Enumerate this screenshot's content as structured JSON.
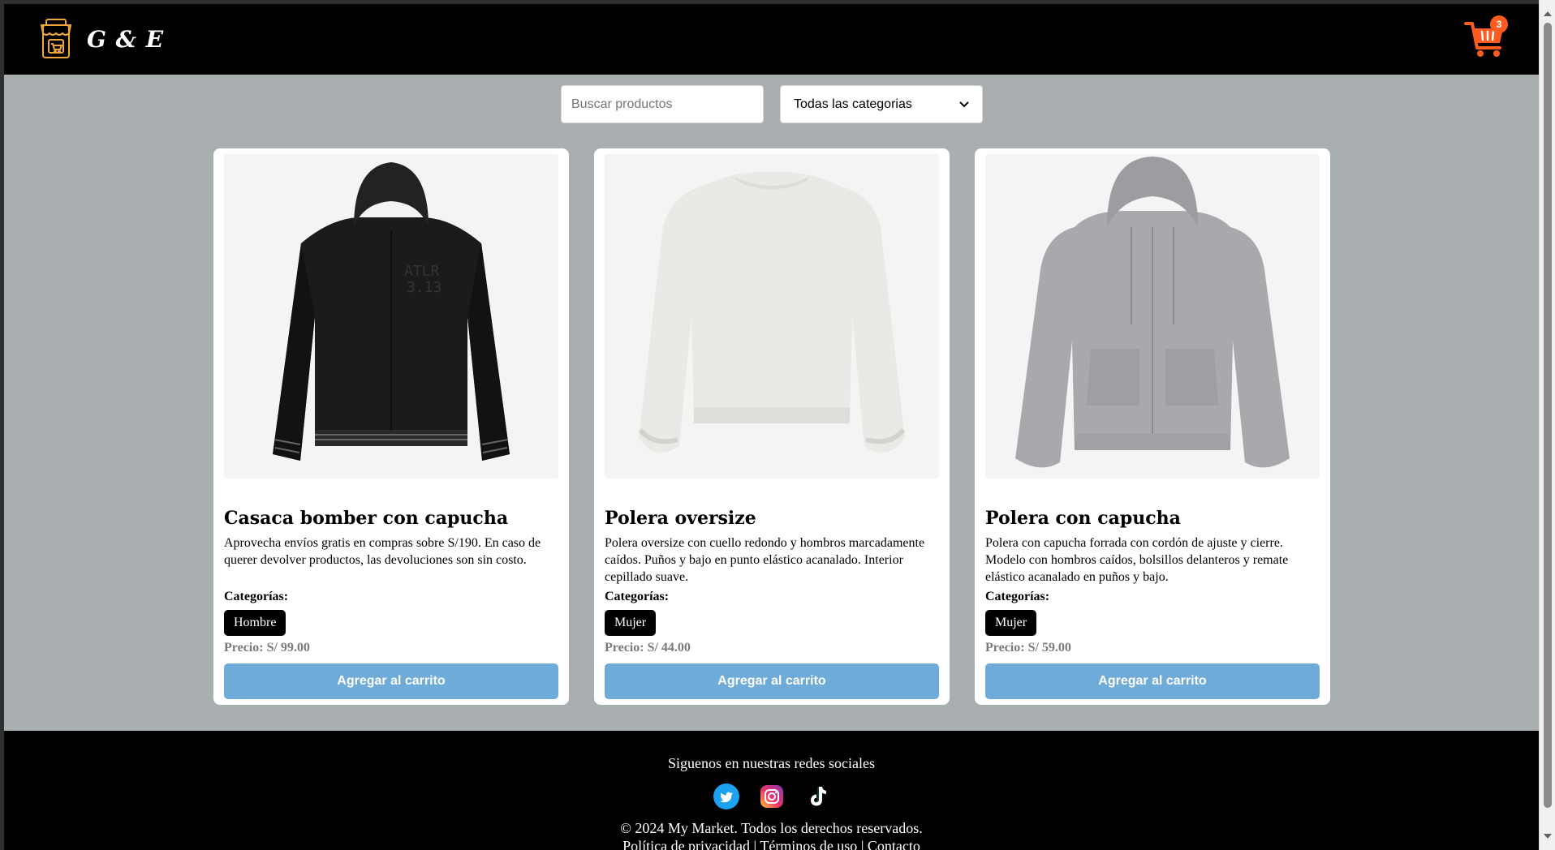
{
  "header": {
    "brand_name": "G & E",
    "brand_icon": "storefront-icon",
    "cart_icon": "shopping-cart-icon",
    "cart_count": "3"
  },
  "filters": {
    "search_placeholder": "Buscar productos",
    "search_value": "",
    "category_selected": "Todas las categorias"
  },
  "products": [
    {
      "title": "Casaca bomber con capucha",
      "description": "Aprovecha envíos gratis en compras sobre S/190. En caso de querer devolver productos, las devoluciones son sin costo.",
      "categories_label": "Categorías:",
      "category": "Hombre",
      "price": "Precio: S/ 99.00",
      "button_label": "Agregar al carrito"
    },
    {
      "title": "Polera oversize",
      "description": "Polera oversize con cuello redondo y hombros marcadamente caídos. Puños y bajo en punto elástico acanalado. Interior cepillado suave.",
      "categories_label": "Categorías:",
      "category": "Mujer",
      "price": "Precio: S/ 44.00",
      "button_label": "Agregar al carrito"
    },
    {
      "title": "Polera con capucha",
      "description": "Polera con capucha forrada con cordón de ajuste y cierre. Modelo con hombros caídos, bolsillos delanteros y remate elástico acanalado en puños y bajo.",
      "categories_label": "Categorías:",
      "category": "Mujer",
      "price": "Precio: S/ 59.00",
      "button_label": "Agregar al carrito"
    }
  ],
  "footer": {
    "social_title": "Siguenos en nuestras redes sociales",
    "social": [
      "twitter-icon",
      "instagram-icon",
      "tiktok-icon"
    ],
    "copyright": "© 2024 My Market. Todos los derechos reservados.",
    "links": [
      "Política de privacidad",
      "Términos de uso",
      "Contacto"
    ],
    "separator": "|"
  },
  "colors": {
    "page_bg": "#a9aeb0",
    "header_bg": "#000000",
    "accent_orange": "#ff5a1f",
    "button_blue": "#6fabd8",
    "chip_bg": "#000000",
    "price_gray": "#7a7a7a"
  }
}
